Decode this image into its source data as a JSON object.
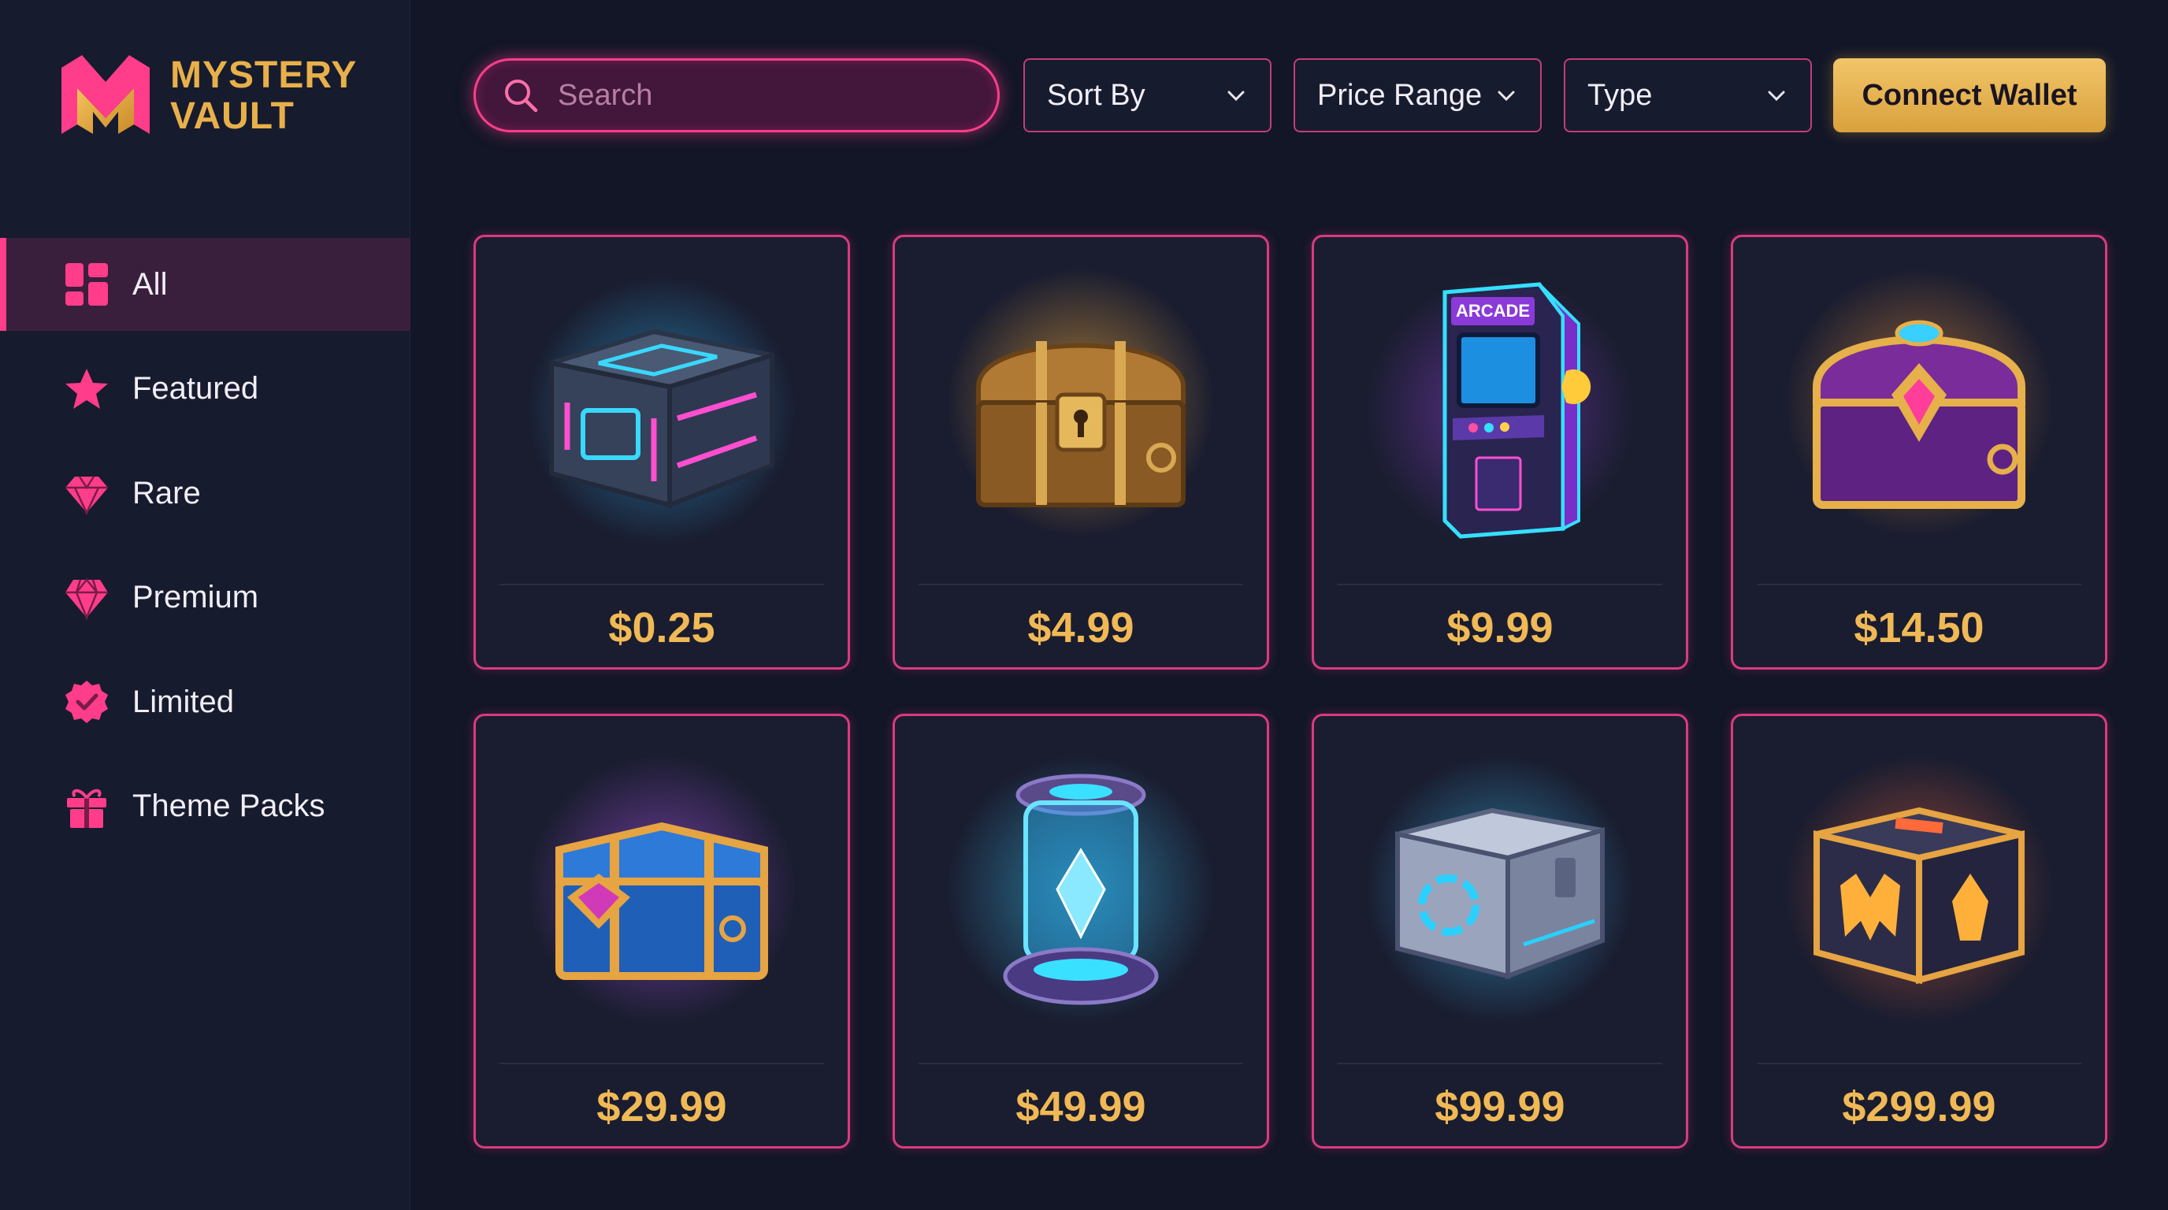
{
  "brand": {
    "line1": "MYSTERY",
    "line2": "VAULT",
    "accent": "#e8b04a",
    "pink": "#ff3d8a"
  },
  "sidebar": {
    "items": [
      {
        "label": "All",
        "icon": "grid-icon",
        "active": true
      },
      {
        "label": "Featured",
        "icon": "star-icon",
        "active": false
      },
      {
        "label": "Rare",
        "icon": "diamond-icon",
        "active": false
      },
      {
        "label": "Premium",
        "icon": "gem-icon",
        "active": false
      },
      {
        "label": "Limited",
        "icon": "badge-check-icon",
        "active": false
      },
      {
        "label": "Theme Packs",
        "icon": "gift-icon",
        "active": false
      }
    ]
  },
  "toolbar": {
    "search_placeholder": "Search",
    "sort_label": "Sort By",
    "price_label": "Price Range",
    "type_label": "Type",
    "wallet_label": "Connect Wallet"
  },
  "products": [
    {
      "price": "$0.25",
      "icon": "cyber-crate-icon"
    },
    {
      "price": "$4.99",
      "icon": "wooden-chest-icon"
    },
    {
      "price": "$9.99",
      "icon": "arcade-cabinet-icon"
    },
    {
      "price": "$14.50",
      "icon": "royal-chest-icon"
    },
    {
      "price": "$29.99",
      "icon": "crystal-chest-icon"
    },
    {
      "price": "$49.99",
      "icon": "energy-capsule-icon"
    },
    {
      "price": "$99.99",
      "icon": "steel-crate-icon"
    },
    {
      "price": "$299.99",
      "icon": "vault-cube-icon"
    }
  ],
  "arcade_sign": "ARCADE"
}
